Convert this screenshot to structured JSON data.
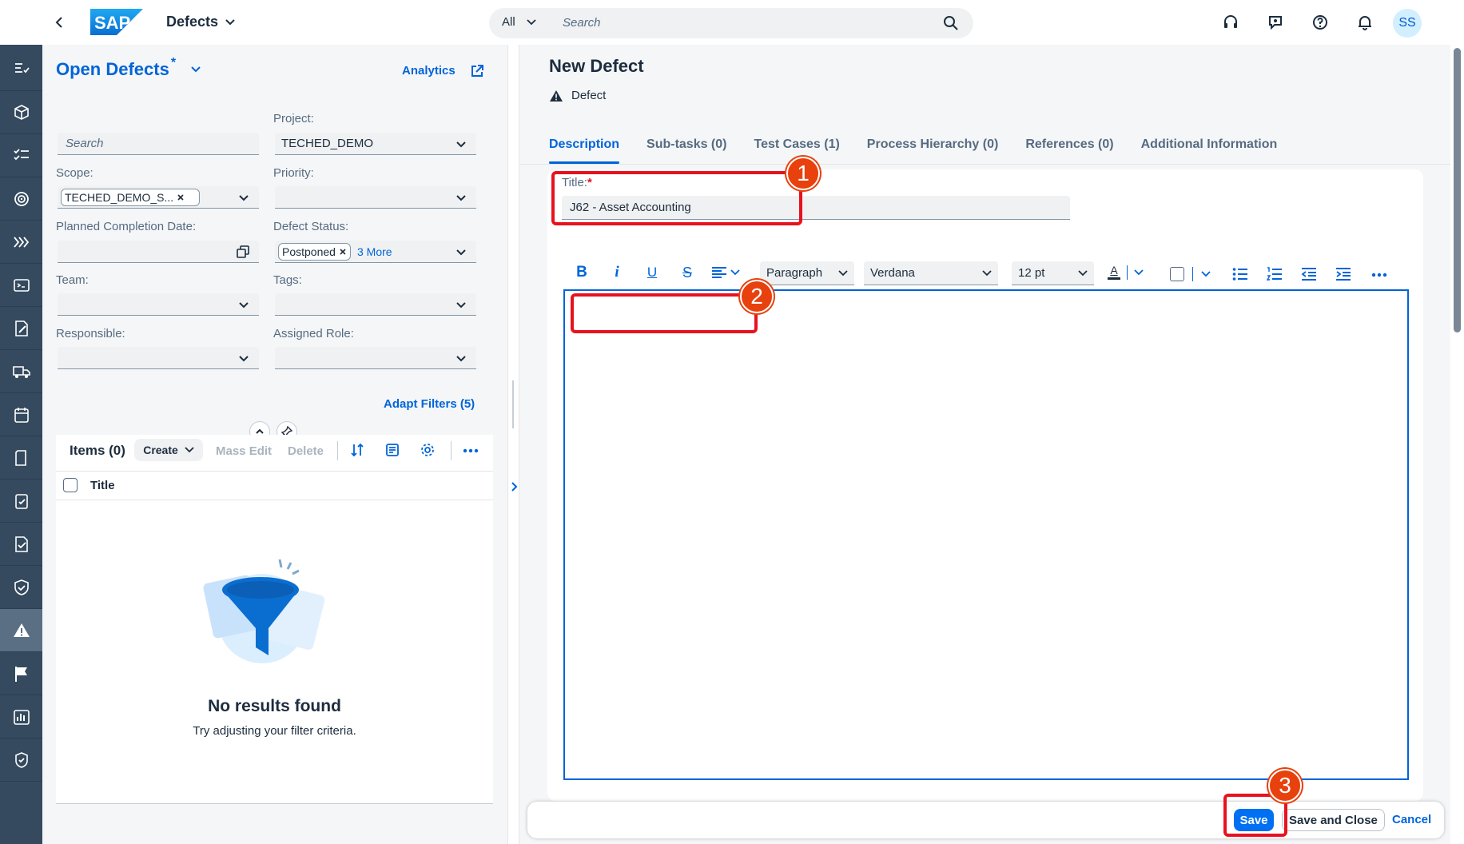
{
  "shell": {
    "app_title": "Defects",
    "search_scope": "All",
    "search_placeholder": "Search",
    "avatar_initials": "SS"
  },
  "sidenav": {
    "icons": [
      "requirements-icon",
      "package-icon",
      "checklist-icon",
      "target-icon",
      "progress-icon",
      "inbox-icon",
      "edit-document-icon",
      "shipping-icon",
      "calendar-icon",
      "document-icon",
      "clipboard-check-icon",
      "quality-icon",
      "shield-icon",
      "warning-icon",
      "flag-icon",
      "report-icon",
      "badge-check-icon"
    ],
    "active_index": 13
  },
  "filters": {
    "variant_title": "Open Defects",
    "variant_modified": "*",
    "analytics_label": "Analytics",
    "search_placeholder": "Search",
    "project_label": "Project:",
    "project_value": "TECHED_DEMO",
    "scope_label": "Scope:",
    "scope_token": "TECHED_DEMO_S...",
    "priority_label": "Priority:",
    "planned_completion_label": "Planned Completion Date:",
    "defect_status_label": "Defect Status:",
    "defect_status_token": "Postponed",
    "defect_status_more": "3 More",
    "team_label": "Team:",
    "tags_label": "Tags:",
    "responsible_label": "Responsible:",
    "assigned_role_label": "Assigned Role:",
    "adapt_filters": "Adapt Filters (5)"
  },
  "table": {
    "items_label": "Items (0)",
    "create_label": "Create",
    "mass_edit_label": "Mass Edit",
    "delete_label": "Delete",
    "column_title": "Title",
    "empty_title": "No results found",
    "empty_subtitle": "Try adjusting your filter criteria."
  },
  "object": {
    "title": "New Defect",
    "type_label": "Defect",
    "tabs": [
      {
        "label": "Description",
        "selected": true
      },
      {
        "label": "Sub-tasks (0)",
        "selected": false
      },
      {
        "label": "Test Cases (1)",
        "selected": false
      },
      {
        "label": "Process Hierarchy (0)",
        "selected": false
      },
      {
        "label": "References (0)",
        "selected": false
      },
      {
        "label": "Additional Information",
        "selected": false
      }
    ],
    "title_field_label": "Title:",
    "required_mark": "*",
    "title_field_value": "J62 - Asset Accounting"
  },
  "editor": {
    "bold_glyph": "B",
    "italic_glyph": "i",
    "underline_glyph": "U",
    "strike_glyph": "S",
    "text_color_glyph": "A",
    "paragraph_format": "Paragraph",
    "font_family": "Verdana",
    "font_size": "12 pt"
  },
  "footer": {
    "save_label": "Save",
    "save_close_label": "Save and Close",
    "cancel_label": "Cancel"
  },
  "annotations": {
    "step1": "1",
    "step2": "2",
    "step3": "3",
    "color": "#e8121f"
  },
  "colors": {
    "brand_blue": "#0064d9",
    "shell_nav": "#354a5f",
    "emphasized_button": "#0070f2"
  }
}
